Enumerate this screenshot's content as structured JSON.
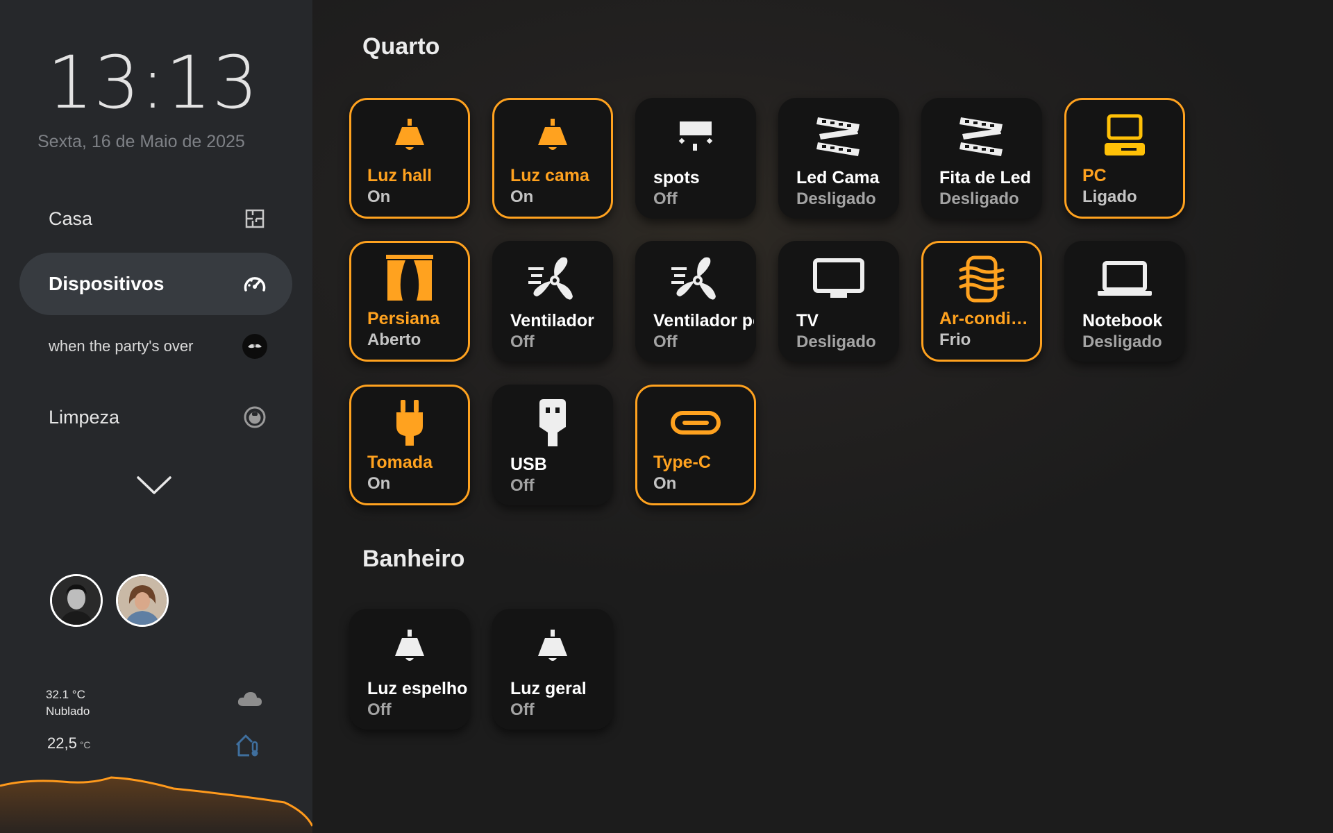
{
  "sidebar": {
    "time": "13:13",
    "date": "Sexta, 16 de Maio de 2025",
    "nav": [
      {
        "label": "Casa",
        "icon": "floorplan-icon"
      },
      {
        "label": "Dispositivos",
        "icon": "speedometer-icon",
        "active": true
      },
      {
        "label": "when the party's over",
        "icon": "album-art-icon"
      },
      {
        "label": "Limpeza",
        "icon": "robot-vacuum-icon"
      }
    ],
    "weather": {
      "temp": "32.1 °C",
      "condition": "Nublado",
      "icon": "cloud-icon"
    },
    "indoor": {
      "value": "22,5",
      "unit": "°C",
      "icon": "home-thermometer-icon"
    }
  },
  "sections": [
    {
      "title": "Quarto",
      "devices": [
        {
          "name": "Luz hall",
          "state": "On",
          "on": true,
          "icon": "ceiling-lamp-icon"
        },
        {
          "name": "Luz cama",
          "state": "On",
          "on": true,
          "icon": "ceiling-lamp-icon"
        },
        {
          "name": "spots",
          "state": "Off",
          "on": false,
          "icon": "spotlight-icon"
        },
        {
          "name": "Led Cama",
          "state": "Desligado",
          "on": false,
          "icon": "led-strip-icon"
        },
        {
          "name": "Fita de Led",
          "state": "Desligado",
          "on": false,
          "icon": "led-strip-icon"
        },
        {
          "name": "PC",
          "state": "Ligado",
          "on": true,
          "icon": "desktop-computer-icon"
        },
        {
          "name": "Persiana",
          "state": "Aberto",
          "on": true,
          "icon": "curtains-icon"
        },
        {
          "name": "Ventilador",
          "state": "Off",
          "on": false,
          "icon": "fan-icon"
        },
        {
          "name": "Ventilador pc",
          "state": "Off",
          "on": false,
          "icon": "fan-icon"
        },
        {
          "name": "TV",
          "state": "Desligado",
          "on": false,
          "icon": "monitor-icon"
        },
        {
          "name": "Ar-condicionado",
          "state": "Frio",
          "on": true,
          "icon": "air-conditioner-icon"
        },
        {
          "name": "Notebook",
          "state": "Desligado",
          "on": false,
          "icon": "laptop-icon"
        },
        {
          "name": "Tomada",
          "state": "On",
          "on": true,
          "icon": "power-plug-icon"
        },
        {
          "name": "USB",
          "state": "Off",
          "on": false,
          "icon": "usb-connector-icon"
        },
        {
          "name": "Type-C",
          "state": "On",
          "on": true,
          "icon": "usb-c-port-icon"
        }
      ]
    },
    {
      "title": "Banheiro",
      "devices": [
        {
          "name": "Luz espelho",
          "state": "Off",
          "on": false,
          "icon": "ceiling-lamp-icon"
        },
        {
          "name": "Luz geral",
          "state": "Off",
          "on": false,
          "icon": "ceiling-lamp-icon"
        }
      ]
    }
  ],
  "colors": {
    "accent": "#ffa21f",
    "tile_bg": "#141414",
    "sidebar_bg": "#26282b",
    "off_icon": "#eeeeee"
  }
}
